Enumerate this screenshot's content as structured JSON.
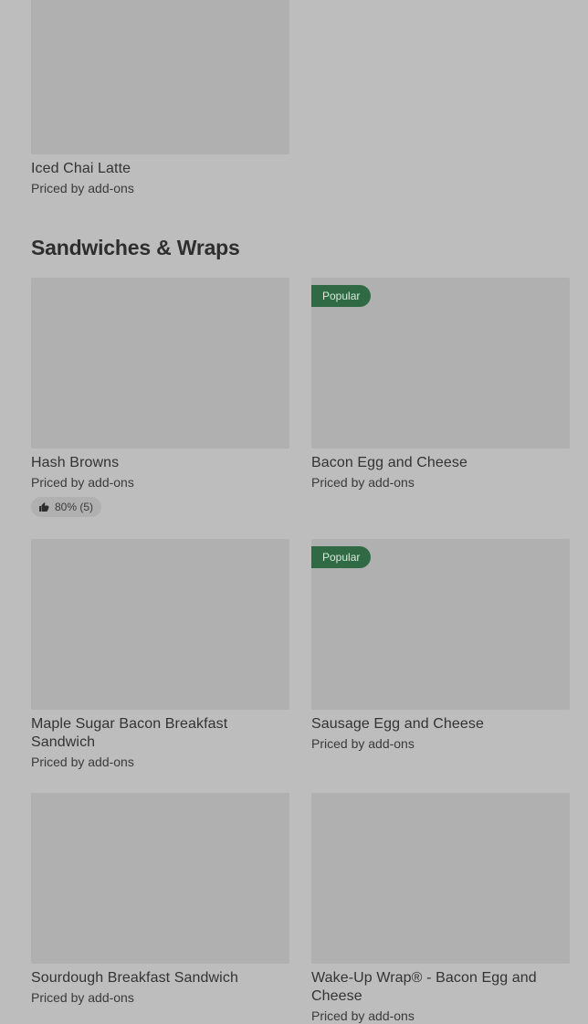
{
  "top_item": {
    "name": "Iced Chai Latte",
    "price": "Priced by add-ons"
  },
  "section": {
    "title": "Sandwiches & Wraps"
  },
  "items": [
    {
      "name": "Hash Browns",
      "price": "Priced by add-ons",
      "rating": "80% (5)"
    },
    {
      "name": "Bacon Egg and Cheese",
      "price": "Priced by add-ons",
      "badge": "Popular"
    },
    {
      "name": "Maple Sugar Bacon Breakfast Sandwich",
      "price": "Priced by add-ons"
    },
    {
      "name": "Sausage Egg and Cheese",
      "price": "Priced by add-ons",
      "badge": "Popular"
    },
    {
      "name": "Sourdough Breakfast Sandwich",
      "price": "Priced by add-ons"
    },
    {
      "name": "Wake-Up Wrap® - Bacon Egg and Cheese",
      "price": "Priced by add-ons"
    }
  ],
  "colors": {
    "background": "#bdbdbd",
    "image_placeholder": "#b0b0b0",
    "badge": "#2f6a45"
  }
}
